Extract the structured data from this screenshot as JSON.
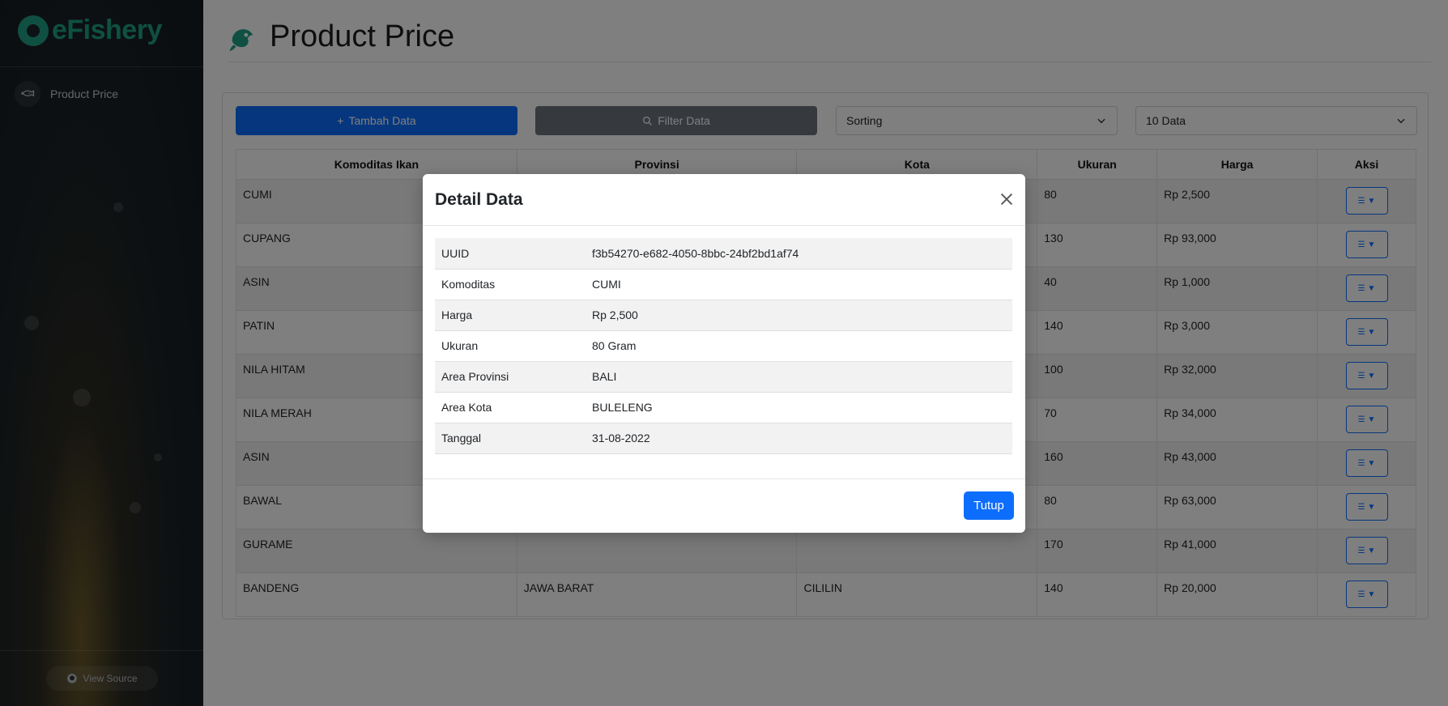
{
  "brand": {
    "name": "eFishery"
  },
  "sidebar": {
    "items": [
      {
        "label": "Product Price",
        "icon": "fish-icon"
      }
    ],
    "footer": {
      "label": "View Source",
      "icon": "github-icon"
    }
  },
  "page": {
    "title": "Product Price"
  },
  "toolbar": {
    "add_label": "Tambah Data",
    "filter_label": "Filter Data",
    "sorting_value": "Sorting",
    "page_size_value": "10 Data"
  },
  "table": {
    "headers": [
      "Komoditas Ikan",
      "Provinsi",
      "Kota",
      "Ukuran",
      "Harga",
      "Aksi"
    ],
    "rows": [
      {
        "komoditas": "CUMI",
        "provinsi": "",
        "kota": "",
        "ukuran": "80",
        "harga": "Rp 2,500"
      },
      {
        "komoditas": "CUPANG",
        "provinsi": "",
        "kota": "",
        "ukuran": "130",
        "harga": "Rp 93,000"
      },
      {
        "komoditas": "ASIN",
        "provinsi": "",
        "kota": "",
        "ukuran": "40",
        "harga": "Rp 1,000"
      },
      {
        "komoditas": "PATIN",
        "provinsi": "",
        "kota": "",
        "ukuran": "140",
        "harga": "Rp 3,000"
      },
      {
        "komoditas": "NILA HITAM",
        "provinsi": "",
        "kota": "",
        "ukuran": "100",
        "harga": "Rp 32,000"
      },
      {
        "komoditas": "NILA MERAH",
        "provinsi": "",
        "kota": "",
        "ukuran": "70",
        "harga": "Rp 34,000"
      },
      {
        "komoditas": "ASIN",
        "provinsi": "",
        "kota": "",
        "ukuran": "160",
        "harga": "Rp 43,000"
      },
      {
        "komoditas": "BAWAL",
        "provinsi": "",
        "kota": "",
        "ukuran": "80",
        "harga": "Rp 63,000"
      },
      {
        "komoditas": "GURAME",
        "provinsi": "",
        "kota": "",
        "ukuran": "170",
        "harga": "Rp 41,000"
      },
      {
        "komoditas": "BANDENG",
        "provinsi": "JAWA BARAT",
        "kota": "CILILIN",
        "ukuran": "140",
        "harga": "Rp 20,000"
      }
    ]
  },
  "modal": {
    "title": "Detail Data",
    "rows": [
      {
        "key": "UUID",
        "value": "f3b54270-e682-4050-8bbc-24bf2bd1af74"
      },
      {
        "key": "Komoditas",
        "value": "CUMI"
      },
      {
        "key": "Harga",
        "value": "Rp 2,500"
      },
      {
        "key": "Ukuran",
        "value": "80 Gram"
      },
      {
        "key": "Area Provinsi",
        "value": "BALI"
      },
      {
        "key": "Area Kota",
        "value": "BULELENG"
      },
      {
        "key": "Tanggal",
        "value": "31-08-2022"
      }
    ],
    "close_label": "Tutup"
  },
  "colors": {
    "brand": "#1fa084",
    "primary": "#0d6efd",
    "secondary": "#6c757d"
  }
}
